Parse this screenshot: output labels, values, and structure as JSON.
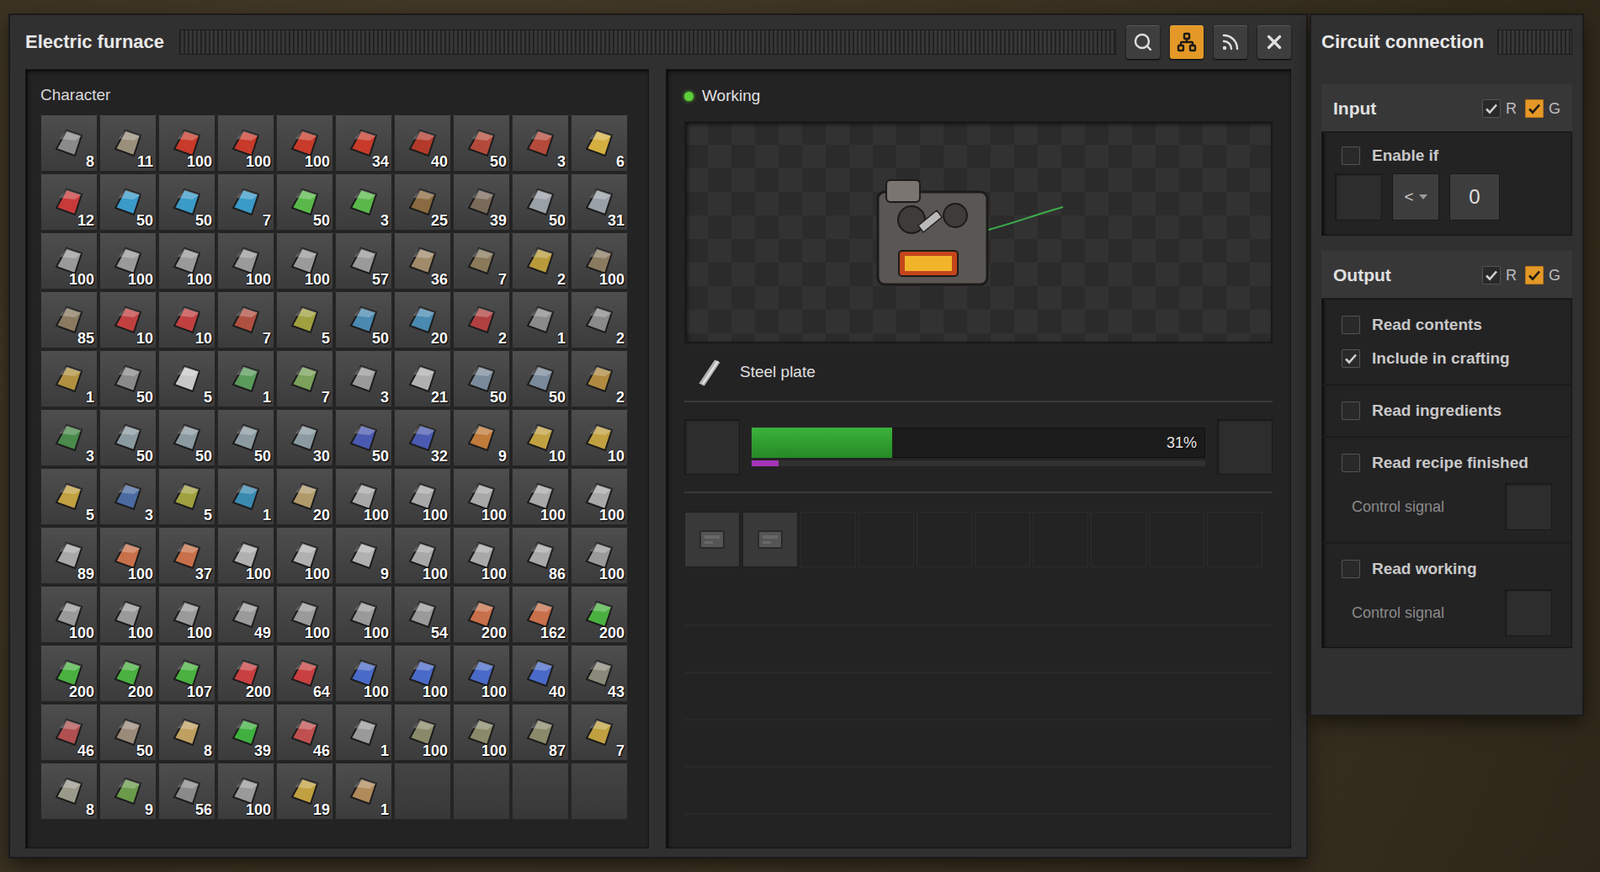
{
  "window": {
    "title": "Electric furnace",
    "header_buttons": [
      {
        "kind": "search",
        "selected": false
      },
      {
        "kind": "network",
        "selected": true
      },
      {
        "kind": "signal",
        "selected": false
      },
      {
        "kind": "close",
        "selected": false
      }
    ]
  },
  "inventory": {
    "title": "Character",
    "slots": [
      {
        "kind": "item",
        "count": "8",
        "color": "#8a8a8a"
      },
      {
        "kind": "item",
        "count": "11",
        "color": "#9a8f7a"
      },
      {
        "kind": "item",
        "count": "100",
        "color": "#c83a2a"
      },
      {
        "kind": "item",
        "count": "100",
        "color": "#c83a2a"
      },
      {
        "kind": "item",
        "count": "100",
        "color": "#c83a2a"
      },
      {
        "kind": "item",
        "count": "34",
        "color": "#c83a2a"
      },
      {
        "kind": "item",
        "count": "40",
        "color": "#b33a2a"
      },
      {
        "kind": "item",
        "count": "50",
        "color": "#b44a3a"
      },
      {
        "kind": "item",
        "count": "3",
        "color": "#b44a3a"
      },
      {
        "kind": "item",
        "count": "6",
        "color": "#d4b040"
      },
      {
        "kind": "item",
        "count": "12",
        "color": "#c83a3a"
      },
      {
        "kind": "item",
        "count": "50",
        "color": "#3a9ac8"
      },
      {
        "kind": "item",
        "count": "50",
        "color": "#3a9ac8"
      },
      {
        "kind": "item",
        "count": "7",
        "color": "#3a9ac8"
      },
      {
        "kind": "item",
        "count": "50",
        "color": "#5ab84a"
      },
      {
        "kind": "item",
        "count": "3",
        "color": "#5ab84a"
      },
      {
        "kind": "item",
        "count": "25",
        "color": "#8a6a40"
      },
      {
        "kind": "item",
        "count": "39",
        "color": "#7a6a5a"
      },
      {
        "kind": "item",
        "count": "50",
        "color": "#9aa0a8"
      },
      {
        "kind": "item",
        "count": "31",
        "color": "#9aa0a8"
      },
      {
        "kind": "item",
        "count": "100",
        "color": "#9a9a9a"
      },
      {
        "kind": "item",
        "count": "100",
        "color": "#9a9a9a"
      },
      {
        "kind": "item",
        "count": "100",
        "color": "#9a9a9a"
      },
      {
        "kind": "item",
        "count": "100",
        "color": "#9a9a9a"
      },
      {
        "kind": "item",
        "count": "100",
        "color": "#9a9a9a"
      },
      {
        "kind": "item",
        "count": "57",
        "color": "#9a9a9a"
      },
      {
        "kind": "item",
        "count": "36",
        "color": "#a08a6a"
      },
      {
        "kind": "item",
        "count": "7",
        "color": "#8a7a5a"
      },
      {
        "kind": "item",
        "count": "2",
        "color": "#b89a3a"
      },
      {
        "kind": "item",
        "count": "100",
        "color": "#8a7a60"
      },
      {
        "kind": "item",
        "count": "85",
        "color": "#8a7a60"
      },
      {
        "kind": "item",
        "count": "10",
        "color": "#c04040"
      },
      {
        "kind": "item",
        "count": "10",
        "color": "#c04040"
      },
      {
        "kind": "item",
        "count": "7",
        "color": "#b05040"
      },
      {
        "kind": "item",
        "count": "5",
        "color": "#a0a040"
      },
      {
        "kind": "item",
        "count": "50",
        "color": "#4a8ab0"
      },
      {
        "kind": "item",
        "count": "20",
        "color": "#4a8ab0"
      },
      {
        "kind": "item",
        "count": "2",
        "color": "#b04040"
      },
      {
        "kind": "item",
        "count": "1",
        "color": "#8a8a8a"
      },
      {
        "kind": "item",
        "count": "2",
        "color": "#8a8a8a"
      },
      {
        "kind": "item",
        "count": "1",
        "color": "#b09040"
      },
      {
        "kind": "item",
        "count": "50",
        "color": "#8a8a8a"
      },
      {
        "kind": "item",
        "count": "5",
        "color": "#c8c8c8"
      },
      {
        "kind": "item",
        "count": "1",
        "color": "#5a9a5a"
      },
      {
        "kind": "item",
        "count": "7",
        "color": "#7aa05a"
      },
      {
        "kind": "item",
        "count": "3",
        "color": "#9a9a9a"
      },
      {
        "kind": "item",
        "count": "21",
        "color": "#b0b0b0"
      },
      {
        "kind": "item",
        "count": "50",
        "color": "#7a8a9a"
      },
      {
        "kind": "item",
        "count": "50",
        "color": "#7a8a9a"
      },
      {
        "kind": "item",
        "count": "2",
        "color": "#b08a40"
      },
      {
        "kind": "item",
        "count": "3",
        "color": "#4a8a4a"
      },
      {
        "kind": "item",
        "count": "50",
        "color": "#8a9aa0"
      },
      {
        "kind": "item",
        "count": "50",
        "color": "#8a9aa0"
      },
      {
        "kind": "item",
        "count": "50",
        "color": "#8a9aa0"
      },
      {
        "kind": "item",
        "count": "30",
        "color": "#8a9aa0"
      },
      {
        "kind": "item",
        "count": "50",
        "color": "#4a5ab0"
      },
      {
        "kind": "item",
        "count": "32",
        "color": "#4a5ab0"
      },
      {
        "kind": "item",
        "count": "9",
        "color": "#c07a3a"
      },
      {
        "kind": "item",
        "count": "10",
        "color": "#c0a040"
      },
      {
        "kind": "item",
        "count": "10",
        "color": "#c0a040"
      },
      {
        "kind": "item",
        "count": "5",
        "color": "#c0a040"
      },
      {
        "kind": "item",
        "count": "3",
        "color": "#4a6aa0"
      },
      {
        "kind": "item",
        "count": "5",
        "color": "#a0a040"
      },
      {
        "kind": "item",
        "count": "1",
        "color": "#3a8ab0"
      },
      {
        "kind": "item",
        "count": "20",
        "color": "#b09a6a"
      },
      {
        "kind": "item",
        "count": "100",
        "color": "#a8a8a8"
      },
      {
        "kind": "item",
        "count": "100",
        "color": "#a8a8a8"
      },
      {
        "kind": "item",
        "count": "100",
        "color": "#a8a8a8"
      },
      {
        "kind": "item",
        "count": "100",
        "color": "#a8a8a8"
      },
      {
        "kind": "item",
        "count": "100",
        "color": "#a8a8a8"
      },
      {
        "kind": "item",
        "count": "89",
        "color": "#a8a8a8"
      },
      {
        "kind": "item",
        "count": "100",
        "color": "#c8704a"
      },
      {
        "kind": "item",
        "count": "37",
        "color": "#c8704a"
      },
      {
        "kind": "item",
        "count": "100",
        "color": "#b0b0b0"
      },
      {
        "kind": "item",
        "count": "100",
        "color": "#b0b0b0"
      },
      {
        "kind": "item",
        "count": "9",
        "color": "#b0b0b0"
      },
      {
        "kind": "item",
        "count": "100",
        "color": "#a8a8a8"
      },
      {
        "kind": "item",
        "count": "100",
        "color": "#a8a8a8"
      },
      {
        "kind": "item",
        "count": "86",
        "color": "#a8a8a8"
      },
      {
        "kind": "item",
        "count": "100",
        "color": "#9a9a9a"
      },
      {
        "kind": "item",
        "count": "100",
        "color": "#9a9a9a"
      },
      {
        "kind": "item",
        "count": "100",
        "color": "#9a9a9a"
      },
      {
        "kind": "item",
        "count": "100",
        "color": "#9a9a9a"
      },
      {
        "kind": "item",
        "count": "49",
        "color": "#9a9a9a"
      },
      {
        "kind": "item",
        "count": "100",
        "color": "#9a9a9a"
      },
      {
        "kind": "item",
        "count": "100",
        "color": "#9a9a9a"
      },
      {
        "kind": "item",
        "count": "54",
        "color": "#9a9a9a"
      },
      {
        "kind": "item",
        "count": "200",
        "color": "#c8704a"
      },
      {
        "kind": "item",
        "count": "162",
        "color": "#c8704a"
      },
      {
        "kind": "item",
        "count": "200",
        "color": "#4ab040"
      },
      {
        "kind": "item",
        "count": "200",
        "color": "#4ab040"
      },
      {
        "kind": "item",
        "count": "200",
        "color": "#4ab040"
      },
      {
        "kind": "item",
        "count": "107",
        "color": "#4ab040"
      },
      {
        "kind": "item",
        "count": "200",
        "color": "#c84040"
      },
      {
        "kind": "item",
        "count": "64",
        "color": "#c84040"
      },
      {
        "kind": "item",
        "count": "100",
        "color": "#4a6ac8"
      },
      {
        "kind": "item",
        "count": "100",
        "color": "#4a6ac8"
      },
      {
        "kind": "item",
        "count": "100",
        "color": "#4a6ac8"
      },
      {
        "kind": "item",
        "count": "40",
        "color": "#4a6ac8"
      },
      {
        "kind": "item",
        "count": "43",
        "color": "#8a8a7a"
      },
      {
        "kind": "item",
        "count": "46",
        "color": "#b05050"
      },
      {
        "kind": "item",
        "count": "50",
        "color": "#9a8a7a"
      },
      {
        "kind": "item",
        "count": "8",
        "color": "#c0a060"
      },
      {
        "kind": "item",
        "count": "39",
        "color": "#40b040"
      },
      {
        "kind": "item",
        "count": "46",
        "color": "#c05050"
      },
      {
        "kind": "item",
        "count": "1",
        "color": "#9a9a9a"
      },
      {
        "kind": "item",
        "count": "100",
        "color": "#8a8a6a"
      },
      {
        "kind": "item",
        "count": "100",
        "color": "#8a8a6a"
      },
      {
        "kind": "item",
        "count": "87",
        "color": "#8a8a6a"
      },
      {
        "kind": "item",
        "count": "7",
        "color": "#c0a040"
      },
      {
        "kind": "item",
        "count": "8",
        "color": "#9a9a8a"
      },
      {
        "kind": "item",
        "count": "9",
        "color": "#6a9a4a"
      },
      {
        "kind": "item",
        "count": "56",
        "color": "#8a8a8a"
      },
      {
        "kind": "item",
        "count": "100",
        "color": "#9a9a9a"
      },
      {
        "kind": "item",
        "count": "19",
        "color": "#c0a040"
      },
      {
        "kind": "item",
        "count": "1",
        "color": "#b08a5a"
      },
      {
        "kind": "empty"
      },
      {
        "kind": "empty"
      },
      {
        "kind": "empty"
      },
      {
        "kind": "empty"
      }
    ]
  },
  "machine": {
    "status": {
      "text": "Working",
      "working": true
    },
    "recipe": {
      "name": "Steel plate"
    },
    "progress": {
      "level": 0.31,
      "reading": "31%",
      "bonus_level": 0.06
    },
    "module_slots": [
      {
        "empty": true
      },
      {
        "empty": true
      }
    ]
  },
  "circuit": {
    "title": "Circuit connection",
    "input": {
      "title": "Input",
      "wires": [
        {
          "label": "R",
          "checked": true,
          "highlighted": false
        },
        {
          "label": "G",
          "checked": true,
          "highlighted": true
        }
      ],
      "enable": {
        "label": "Enable if",
        "checked": false
      },
      "condition": {
        "comparator": "<",
        "constant": "0"
      }
    },
    "output": {
      "title": "Output",
      "wires": [
        {
          "label": "R",
          "checked": true,
          "highlighted": false
        },
        {
          "label": "G",
          "checked": true,
          "highlighted": true
        }
      ],
      "groups": [
        {
          "rows": [
            {
              "kind": "checkbox",
              "label": "Read contents",
              "checked": false
            },
            {
              "kind": "checkbox",
              "label": "Include in crafting",
              "checked": true
            }
          ]
        },
        {
          "rows": [
            {
              "kind": "checkbox",
              "label": "Read ingredients",
              "checked": false
            }
          ]
        },
        {
          "rows": [
            {
              "kind": "checkbox",
              "label": "Read recipe finished",
              "checked": false
            },
            {
              "kind": "signal",
              "label": "Control signal",
              "disabled": true
            }
          ]
        },
        {
          "rows": [
            {
              "kind": "checkbox",
              "label": "Read working",
              "checked": false
            },
            {
              "kind": "signal",
              "label": "Control signal",
              "disabled": true
            }
          ]
        }
      ]
    }
  }
}
